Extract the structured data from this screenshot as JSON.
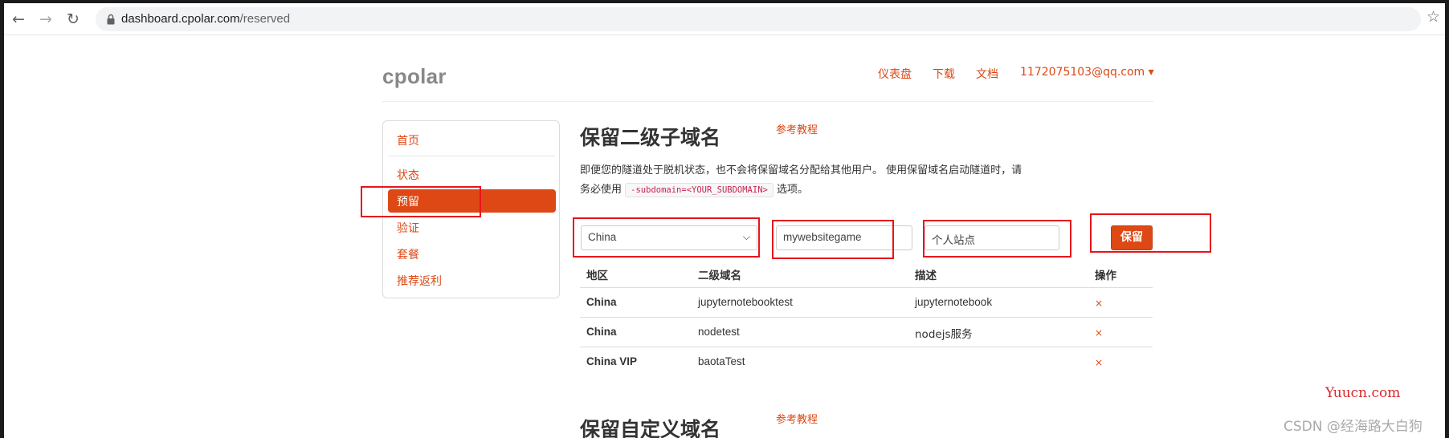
{
  "browser": {
    "url_host": "dashboard.cpolar.com",
    "url_path": "/reserved"
  },
  "header": {
    "brand": "cpolar",
    "nav": [
      "仪表盘",
      "下载",
      "文档",
      "1172075103@qq.com ▾"
    ]
  },
  "sidebar": {
    "items": [
      {
        "label": "首页"
      },
      {
        "label": "状态"
      },
      {
        "label": "预留",
        "active": true
      },
      {
        "label": "验证"
      },
      {
        "label": "套餐"
      },
      {
        "label": "推荐返利"
      }
    ]
  },
  "main": {
    "title": "保留二级子域名",
    "ref_link": "参考教程",
    "description_part1": "即便您的隧道处于脱机状态，也不会将保留域名分配给其他用户。 使用保留域名启动隧道时，请务必使用",
    "description_code": "-subdomain=<YOUR_SUBDOMAIN>",
    "description_part2": "选项。",
    "form": {
      "region_value": "China",
      "subdomain_value": "mywebsitegame",
      "description_value": "个人站点",
      "save_label": "保留"
    },
    "table": {
      "headers": [
        "地区",
        "二级域名",
        "描述",
        "操作"
      ],
      "rows": [
        {
          "region": "China",
          "subdomain": "jupyternotebooktest",
          "description": "jupyternotebook",
          "action": "×"
        },
        {
          "region": "China",
          "subdomain": "nodetest",
          "description": "nodejs服务",
          "action": "×"
        },
        {
          "region": "China VIP",
          "subdomain": "baotaTest",
          "description": "",
          "action": "×"
        }
      ]
    },
    "custom_title": "保留自定义域名",
    "custom_ref_link": "参考教程"
  },
  "watermarks": {
    "site": "Yuucn.com",
    "csdn": "CSDN @经海路大白狗"
  },
  "colors": {
    "accent": "#dd4814",
    "highlight_box": "#e8141b"
  }
}
